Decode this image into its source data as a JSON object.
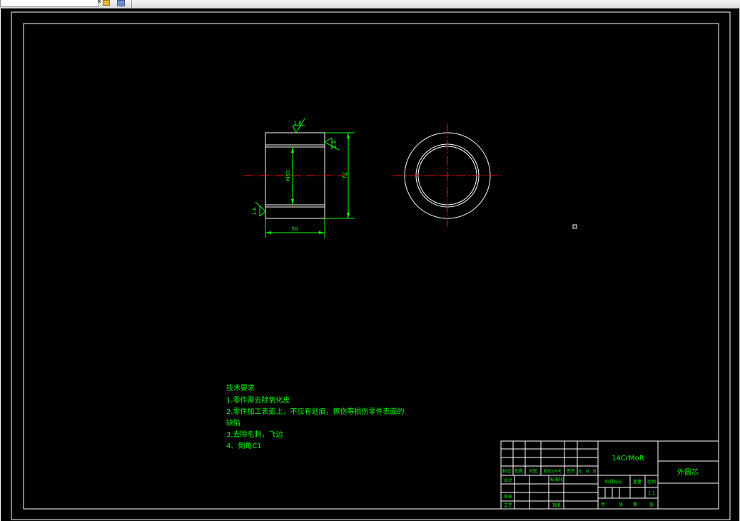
{
  "drawing": {
    "dimensions": {
      "outer_diameter": "72",
      "bore": "M50",
      "length": "50"
    },
    "roughness": {
      "top": "1.6",
      "right": "1.6",
      "left": "1.6"
    },
    "tech_requirements": {
      "heading": "技术要求",
      "lines": [
        "1.零件需去除氧化皮",
        "2.零件加工表面上，不应有划痕，擦伤等损伤零件表面的",
        "缺陷",
        "3.去除毛刺，飞边",
        "4、倒角C1"
      ]
    },
    "title_block": {
      "material": "14CrMoR",
      "part_name": "外圆芯",
      "scale": "1:1",
      "header_cells": [
        "标记",
        "处数",
        "分区",
        "更改文件号",
        "签名",
        "年、月、日"
      ],
      "design": "设计",
      "standardize": "标准化",
      "stage_mark": "阶段标记",
      "weight": "重量",
      "scale_label": "比例",
      "review": "审核",
      "process": "工艺",
      "approve": "批准",
      "sheet_cells": [
        "共",
        "张",
        "第",
        "张"
      ]
    }
  },
  "colors": {
    "background": "#000000",
    "frame": "#ffffff",
    "dimension": "#00ff00",
    "centerline": "#ff0000"
  }
}
